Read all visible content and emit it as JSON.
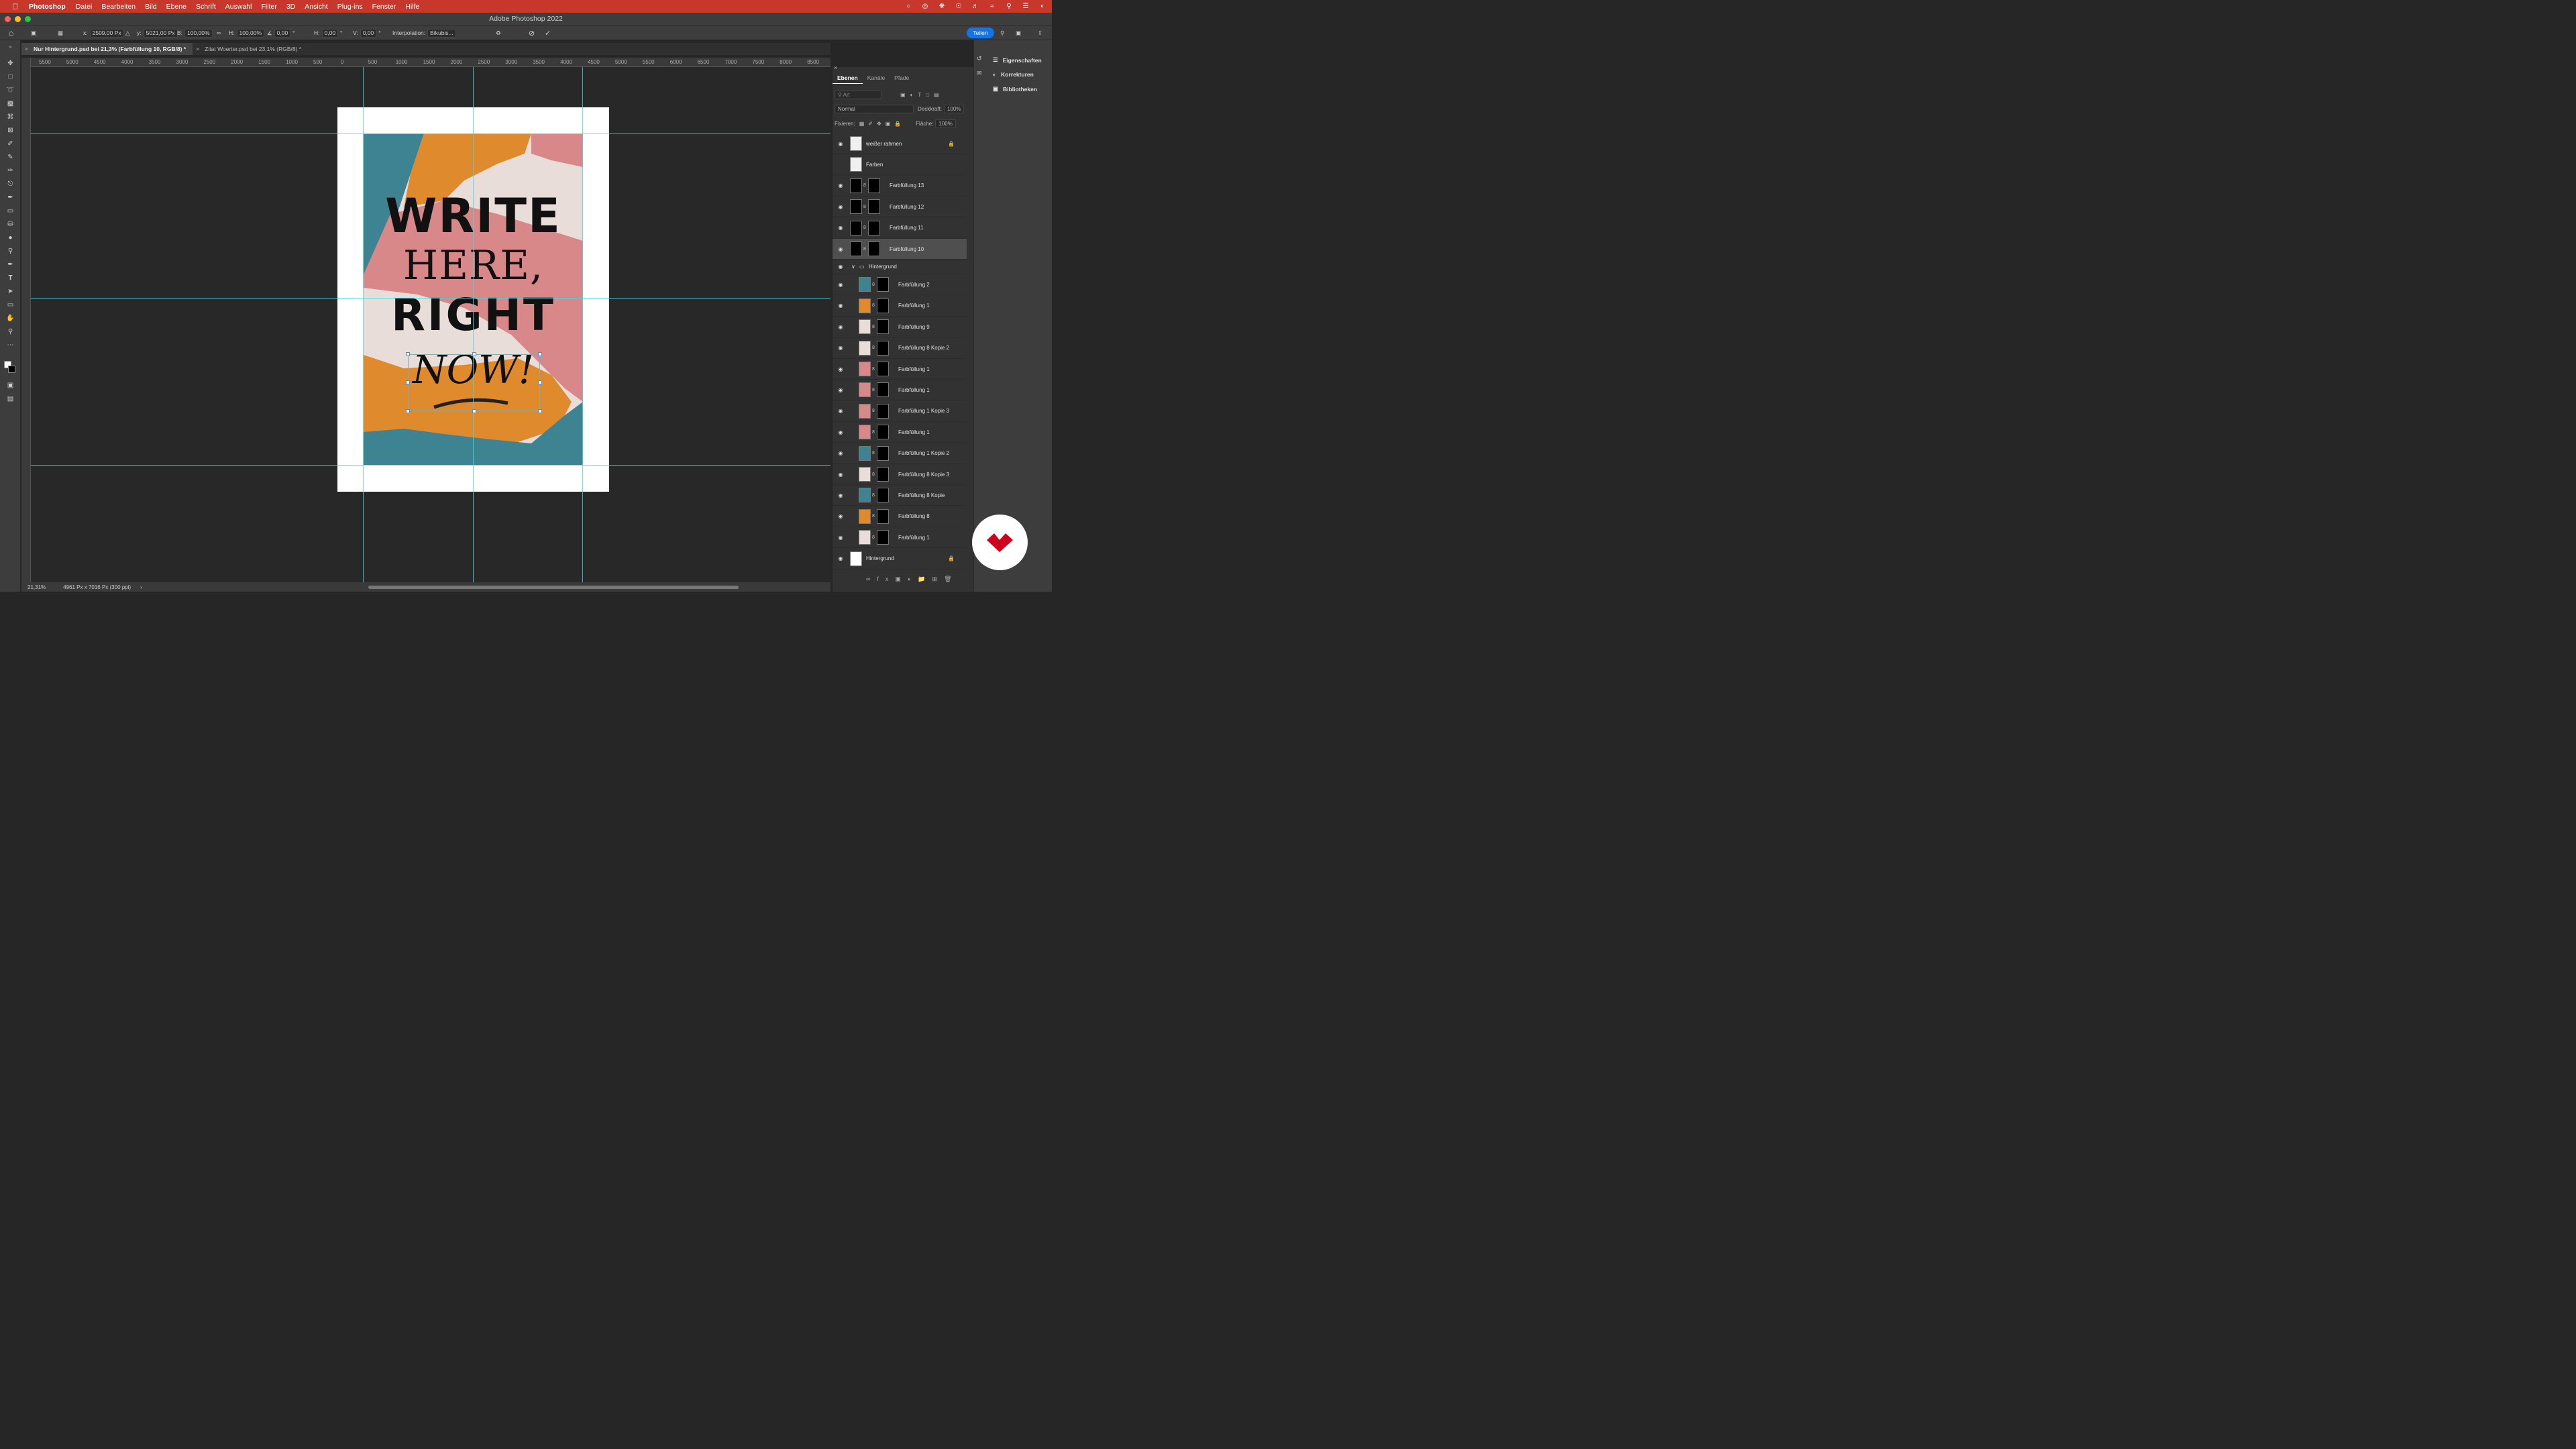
{
  "menubar": {
    "app": "Photoshop",
    "items": [
      "Datei",
      "Bearbeiten",
      "Bild",
      "Ebene",
      "Schrift",
      "Auswahl",
      "Filter",
      "3D",
      "Ansicht",
      "Plug-ins",
      "Fenster",
      "Hilfe"
    ]
  },
  "window": {
    "title": "Adobe Photoshop 2022"
  },
  "options": {
    "x": "2509,00 Px",
    "y": "5021,00 Px",
    "b": "100,00%",
    "h": "100,00%",
    "angle": "0,00",
    "hskew": "0,00",
    "vskew": "0,00",
    "interpolation_label": "Interpolation:",
    "interpolation": "Bikubis...",
    "share": "Teilen"
  },
  "tabs": [
    {
      "label": "Nur Hintergrund.psd bei 21,3% (Farbfüllung 10, RGB/8) *"
    },
    {
      "label": "Zitat Woerter.psd bei 23,1% (RGB/8) *"
    }
  ],
  "ruler_h": [
    "5500",
    "5000",
    "4500",
    "4000",
    "3500",
    "3000",
    "2500",
    "2000",
    "1500",
    "1000",
    "500",
    "0",
    "500",
    "1000",
    "1500",
    "2000",
    "2500",
    "3000",
    "3500",
    "4000",
    "4500",
    "5000",
    "5500",
    "6000",
    "6500",
    "7000",
    "7500",
    "8000",
    "8500",
    "9000",
    "9500",
    "10000",
    "10500",
    "11000"
  ],
  "poster": {
    "line1": "WRITE",
    "line2": "HERE,",
    "line3": "RIGHT",
    "line4": "NOW!",
    "colors": {
      "teal": "#3d8391",
      "orange": "#e08a2e",
      "pink": "#d98889",
      "cream": "#e8ddd8"
    }
  },
  "status": {
    "zoom": "21,31%",
    "info": "4961 Px x 7016 Px (300 ppi)"
  },
  "panel": {
    "tabs": [
      "Ebenen",
      "Kanäle",
      "Pfade"
    ],
    "search": "Art",
    "blend": "Normal",
    "opacity_label": "Deckkraft:",
    "opacity": "100%",
    "lock_label": "Fixieren:",
    "fill_label": "Fläche:",
    "fill": "100%"
  },
  "layers": [
    {
      "name": "weißer rahmen",
      "thumb": "#f0f0f0",
      "locked": true,
      "visible": true,
      "indent": false,
      "mask": false
    },
    {
      "name": "Farben",
      "thumb": "#f0f0f0",
      "visible": false,
      "indent": false,
      "mask": false
    },
    {
      "name": "Farbfüllung 13",
      "thumb": "#000000",
      "visible": true,
      "indent": false,
      "mask": true
    },
    {
      "name": "Farbfüllung 12",
      "thumb": "#000000",
      "visible": true,
      "indent": false,
      "mask": true
    },
    {
      "name": "Farbfüllung 11",
      "thumb": "#000000",
      "visible": true,
      "indent": false,
      "mask": true
    },
    {
      "name": "Farbfüllung 10",
      "thumb": "#000000",
      "visible": true,
      "indent": false,
      "mask": true,
      "selected": true
    },
    {
      "name": "Hintergrund",
      "group": true,
      "visible": true
    },
    {
      "name": "Farbfüllung 2",
      "thumb": "#3d8391",
      "visible": true,
      "indent": true,
      "mask": true
    },
    {
      "name": "Farbfüllung 1",
      "thumb": "#e08a2e",
      "visible": true,
      "indent": true,
      "mask": true
    },
    {
      "name": "Farbfüllung 9",
      "thumb": "#e8ddd8",
      "visible": true,
      "indent": true,
      "mask": true
    },
    {
      "name": "Farbfüllung 8 Kopie 2",
      "thumb": "#e8ddd8",
      "visible": true,
      "indent": true,
      "mask": true
    },
    {
      "name": "Farbfüllung 1",
      "thumb": "#d98889",
      "visible": true,
      "indent": true,
      "mask": true
    },
    {
      "name": "Farbfüllung 1",
      "thumb": "#d98889",
      "visible": true,
      "indent": true,
      "mask": true
    },
    {
      "name": "Farbfüllung 1 Kopie 3",
      "thumb": "#d98889",
      "visible": true,
      "indent": true,
      "mask": true
    },
    {
      "name": "Farbfüllung 1",
      "thumb": "#d98889",
      "visible": true,
      "indent": true,
      "mask": true
    },
    {
      "name": "Farbfüllung 1 Kopie 2",
      "thumb": "#3d8391",
      "visible": true,
      "indent": true,
      "mask": true
    },
    {
      "name": "Farbfüllung 8 Kopie 3",
      "thumb": "#e8ddd8",
      "visible": true,
      "indent": true,
      "mask": true
    },
    {
      "name": "Farbfüllung 8 Kopie",
      "thumb": "#3d8391",
      "visible": true,
      "indent": true,
      "mask": true
    },
    {
      "name": "Farbfüllung 8",
      "thumb": "#e08a2e",
      "visible": true,
      "indent": true,
      "mask": true
    },
    {
      "name": "Farbfüllung 1",
      "thumb": "#e8ddd8",
      "visible": true,
      "indent": true,
      "mask": true
    },
    {
      "name": "Hintergrund",
      "thumb": "#ffffff",
      "locked": true,
      "visible": true,
      "indent": false,
      "mask": false
    }
  ],
  "dock": [
    "Eigenschaften",
    "Korrekturen",
    "Bibliotheken"
  ]
}
